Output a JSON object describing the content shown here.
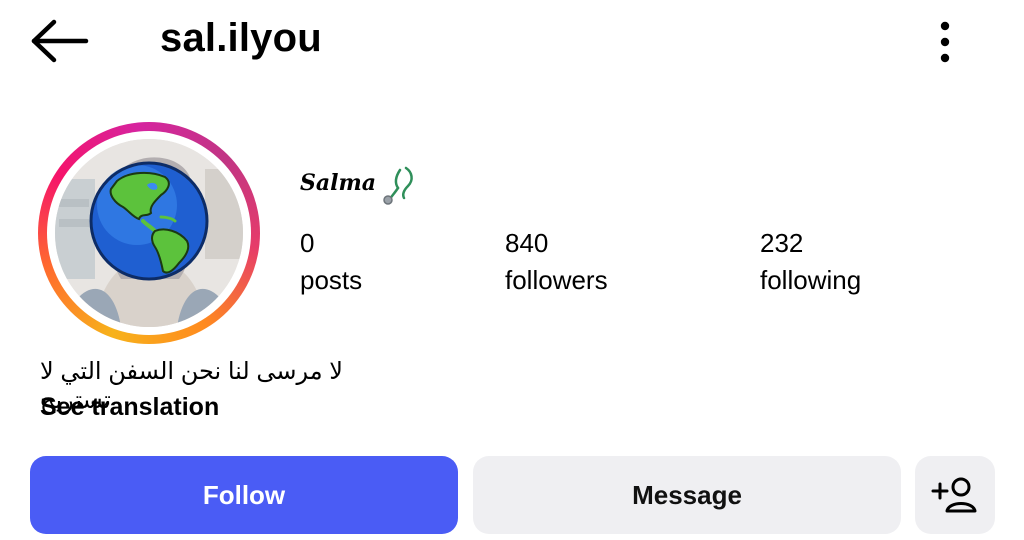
{
  "header": {
    "username": "sal.ilyou",
    "back_icon": "arrow-left-icon",
    "more_icon": "more-vertical-icon"
  },
  "profile": {
    "display_name": "Salma",
    "display_name_icon": "stethoscope-icon",
    "avatar_icon": "globe-americas-icon",
    "ring_colors": [
      "#f7b21b",
      "#ff6a2e",
      "#f5136b",
      "#d6249f"
    ],
    "stats": [
      {
        "value": "0",
        "label": "posts"
      },
      {
        "value": "840",
        "label": "followers"
      },
      {
        "value": "232",
        "label": "following"
      }
    ],
    "bio": "لا مرسى لنا نحن السفن التي لا تستريح",
    "see_translation": "See translation"
  },
  "actions": {
    "follow_label": "Follow",
    "message_label": "Message",
    "add_person_icon": "person-add-icon"
  },
  "colors": {
    "accent": "#4a5cf5",
    "secondary_button": "#efeff2"
  }
}
